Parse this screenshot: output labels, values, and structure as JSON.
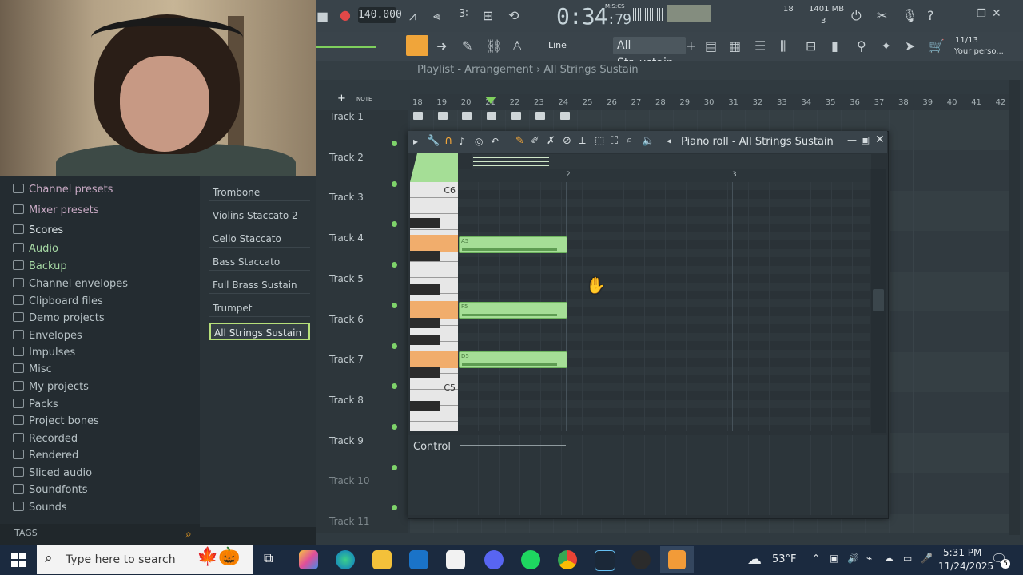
{
  "toolbar": {
    "tempo": "140.000",
    "time": "0:34",
    "time_small": ":79",
    "time_unit": "M:S:CS",
    "cpu": "18",
    "memory": "1401 MB",
    "poly": "3",
    "snap": "Line",
    "pattern": "All Str..ustain",
    "hint_date": "11/13",
    "hint_text": "Your perso..."
  },
  "browser": {
    "items": [
      "Channel presets",
      "Mixer presets",
      "Scores",
      "Audio",
      "Backup",
      "Channel envelopes",
      "Clipboard files",
      "Demo projects",
      "Envelopes",
      "Impulses",
      "Misc",
      "My projects",
      "Packs",
      "Project bones",
      "Recorded",
      "Rendered",
      "Sliced audio",
      "Soundfonts",
      "Sounds"
    ],
    "tags_label": "TAGS"
  },
  "channels": [
    "Trombone",
    "Violins Staccato 2",
    "Cello Staccato",
    "Bass Staccato",
    "Full Brass Sustain",
    "Trumpet",
    "All Strings Sustain"
  ],
  "playlist": {
    "breadcrumb": "Playlist - Arrangement › All Strings Sustain",
    "ruler": [
      "18",
      "19",
      "20",
      "21",
      "22",
      "23",
      "24",
      "25",
      "26",
      "27",
      "28",
      "29",
      "30",
      "31",
      "32",
      "33",
      "34",
      "35",
      "36",
      "37",
      "38",
      "39",
      "40",
      "41",
      "42"
    ],
    "tracks": [
      "Track 1",
      "Track 2",
      "Track 3",
      "Track 4",
      "Track 5",
      "Track 6",
      "Track 7",
      "Track 8",
      "Track 9",
      "Track 10",
      "Track 11"
    ]
  },
  "piano_roll": {
    "title": "Piano roll - All Strings Sustain",
    "bar_labels": [
      "2",
      "3"
    ],
    "key_labels": [
      "C6",
      "C5"
    ],
    "notes": [
      {
        "label": "A5"
      },
      {
        "label": "F5"
      },
      {
        "label": "D5"
      }
    ],
    "control_label": "Control"
  },
  "taskbar": {
    "search_placeholder": "Type here to search",
    "weather": "53°F",
    "clock_time": "5:31 PM",
    "clock_date": "11/24/2025",
    "notif_count": "5"
  },
  "colors": {
    "accent": "#b7e07a",
    "note": "#a5de96",
    "key_highlight": "#f1ad6c"
  }
}
